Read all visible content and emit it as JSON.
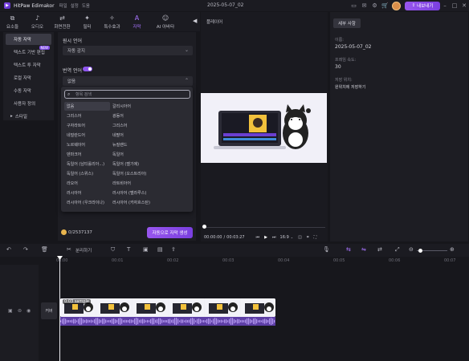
{
  "titlebar": {
    "app_name": "HitPaw Edimakor",
    "menu": [
      "파일",
      "설정",
      "도움"
    ],
    "doc_title": "2025-05-07_02",
    "export_label": "내보내기"
  },
  "toolbar": {
    "tools": [
      {
        "label": "요소들",
        "icon": "layers-icon",
        "glyph": "⧉"
      },
      {
        "label": "오디오",
        "icon": "music-note-icon",
        "glyph": "♪"
      },
      {
        "label": "화면전환",
        "icon": "transition-icon",
        "glyph": "⇄"
      },
      {
        "label": "필터",
        "icon": "filter-icon",
        "glyph": "✦"
      },
      {
        "label": "특수효과",
        "icon": "effects-icon",
        "glyph": "✧"
      },
      {
        "label": "자막",
        "icon": "text-icon",
        "glyph": "A"
      },
      {
        "label": "AI 아바타",
        "icon": "avatar-icon",
        "glyph": "☺"
      }
    ],
    "active_index": 5
  },
  "leftnav": {
    "items": [
      "자동 자막",
      "텍스트 기반 편집",
      "텍스트 투 자막",
      "로컬 자막",
      "수동 자막",
      "사용자 정의",
      "스타일"
    ],
    "new_badge": "NEW",
    "active_index": 0
  },
  "settings": {
    "source_label": "원시 언어",
    "source_value": "자동 감지",
    "translate_label": "번역 언어",
    "translate_value": "없음"
  },
  "dropdown": {
    "search_placeholder": "항목 검색",
    "left": [
      "없음",
      "그리스어",
      "구자라트어",
      "네덜란드어",
      "노르웨이어",
      "덴마크어",
      "독일어 (남티롤리아...)",
      "독일어 (스위스)",
      "라오어",
      "러시아어",
      "러시아어 (우크라이나)"
    ],
    "right": [
      "갈리시아어",
      "광동어",
      "그리스어",
      "네팔어",
      "뉴질랜드",
      "독일어",
      "독일어 (벨기에)",
      "독일어 (오스트리아)",
      "라트비아어",
      "러시아어 (벨라루스)",
      "러시아어 (카자흐스탄)"
    ]
  },
  "credits": {
    "value": "0/2537137"
  },
  "auto_button": "자동으로 자막 생성",
  "player": {
    "title": "플레이어",
    "time_current": "00:00:00",
    "time_total": "00:03:27",
    "ratio": "16:9",
    "progress": 0
  },
  "props": {
    "tab": "세부 사항",
    "name_label": "이름:",
    "name_value": "2025-05-07_02",
    "fps_label": "프레임 속도:",
    "fps_value": "30",
    "save_label": "저장 위치:",
    "save_value": "원위치에 저장하기"
  },
  "timeline": {
    "split_label": "분리하기",
    "ticks": [
      "00:00",
      "00:01",
      "00:02",
      "00:03",
      "00:04",
      "00:05",
      "00:06",
      "00:07"
    ],
    "clip_name": "0:03 sample",
    "cover_label": "커버"
  }
}
